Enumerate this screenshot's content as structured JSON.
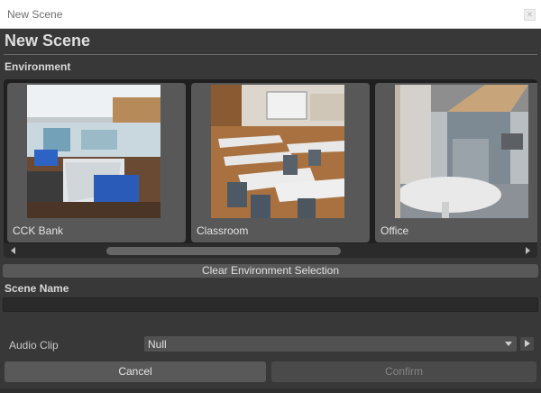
{
  "window": {
    "title": "New Scene",
    "close_icon": "close-icon"
  },
  "header": {
    "title": "New Scene"
  },
  "environment": {
    "section_label": "Environment",
    "cards": [
      {
        "label": "CCK Bank"
      },
      {
        "label": "Classroom"
      },
      {
        "label": "Office"
      }
    ],
    "clear_label": "Clear Environment Selection"
  },
  "scene_name": {
    "label": "Scene Name",
    "value": ""
  },
  "audio_clip": {
    "label": "Audio Clip",
    "value": "Null"
  },
  "footer": {
    "cancel_label": "Cancel",
    "confirm_label": "Confirm"
  },
  "colors": {
    "panel_bg": "#383838",
    "card_bg": "#585858",
    "scroll_bg": "#202020",
    "field_bg": "#2a2a2a",
    "disabled_text": "#858585"
  }
}
